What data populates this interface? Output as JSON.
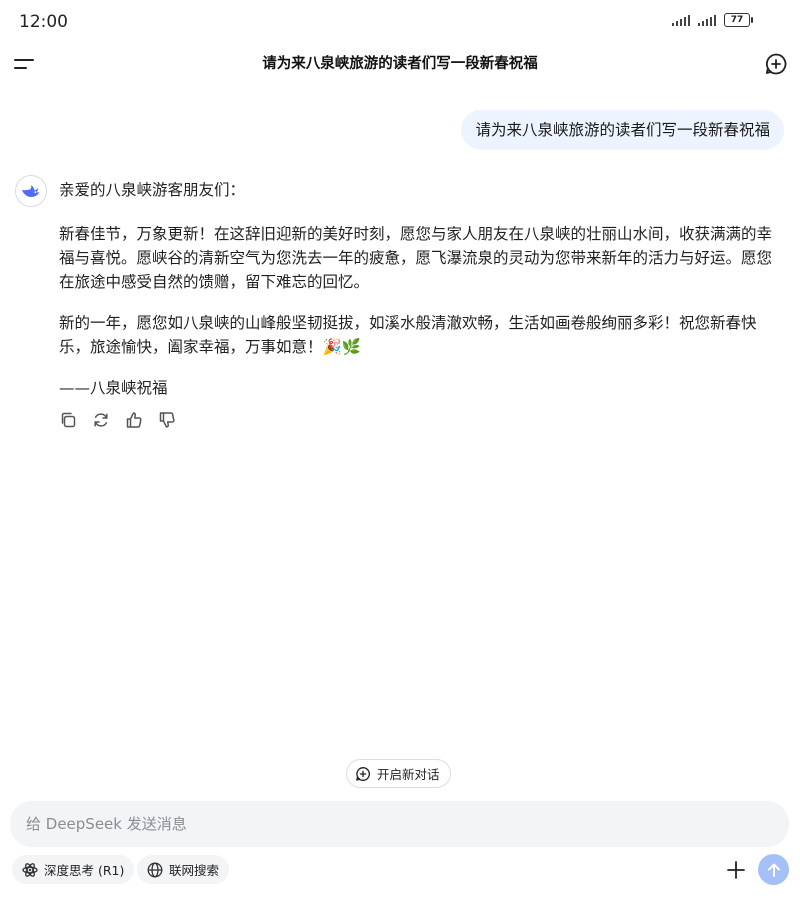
{
  "status_bar": {
    "time": "12:00",
    "battery": "77"
  },
  "header": {
    "title": "请为来八泉峡旅游的读者们写一段新春祝福"
  },
  "conversation": {
    "user_message": "请为来八泉峡旅游的读者们写一段新春祝福",
    "assistant": {
      "greeting": "亲爱的八泉峡游客朋友们：",
      "paragraph1": "新春佳节，万象更新！在这辞旧迎新的美好时刻，愿您与家人朋友在八泉峡的壮丽山水间，收获满满的幸福与喜悦。愿峡谷的清新空气为您洗去一年的疲惫，愿飞瀑流泉的灵动为您带来新年的活力与好运。愿您在旅途中感受自然的馈赠，留下难忘的回忆。",
      "paragraph2": "新的一年，愿您如八泉峡的山峰般坚韧挺拔，如溪水般清澈欢畅，生活如画卷般绚丽多彩！祝您新春快乐，旅途愉快，阖家幸福，万事如意！🎉🌿",
      "signature": "——八泉峡祝福"
    },
    "actions": [
      "copy-icon",
      "refresh-icon",
      "thumbs-up-icon",
      "thumbs-down-icon"
    ]
  },
  "new_chat": {
    "label": "开启新对话"
  },
  "composer": {
    "placeholder": "给 DeepSeek 发送消息",
    "deep_think_label": "深度思考 (R1)",
    "web_search_label": "联网搜索"
  },
  "colors": {
    "accent": "#4d6bfe",
    "send_button": "#a4c0f7",
    "bubble": "#eef4ff"
  }
}
